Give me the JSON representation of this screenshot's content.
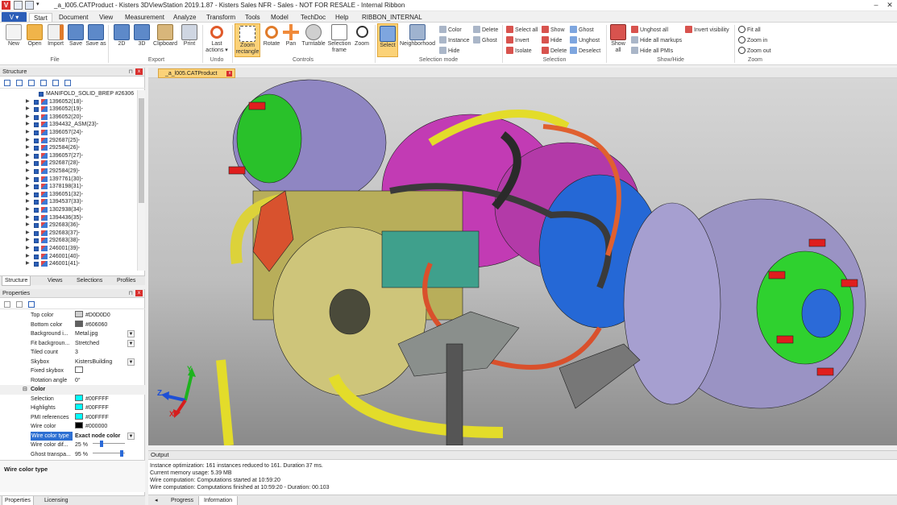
{
  "window": {
    "title": "_a_l005.CATProduct - Kisters 3DViewStation 2019.1.87 - Kisters Sales NFR - Sales - NOT FOR RESALE - Internal Ribbon",
    "min": "–",
    "close": "✕"
  },
  "menu": {
    "file_label": "V ▾",
    "tabs": [
      "Start",
      "Document",
      "View",
      "Measurement",
      "Analyze",
      "Transform",
      "Tools",
      "Model",
      "TechDoc",
      "Help",
      "RIBBON_INTERNAL"
    ],
    "active_tab": "Start"
  },
  "ribbon": {
    "file": {
      "new": "New",
      "open": "Open",
      "import": "Import",
      "save": "Save",
      "save_as": "Save as",
      "group": "File"
    },
    "export": {
      "e2d": "2D",
      "e3d": "3D",
      "clipboard": "Clipboard",
      "print": "Print",
      "group": "Export"
    },
    "undo": {
      "last_actions": "Last actions ▾",
      "group": "Undo"
    },
    "controls": {
      "zoom_rect": "Zoom rectangle",
      "rotate": "Rotate",
      "pan": "Pan",
      "turntable": "Turntable",
      "selection_frame": "Selection frame",
      "zoom": "Zoom",
      "group": "Controls"
    },
    "selmode": {
      "select": "Select",
      "neighborhood": "Neighborhood",
      "color": "Color",
      "instance": "Instance",
      "hide": "Hide",
      "delete": "Delete",
      "ghost": "Ghost",
      "group": "Selection mode"
    },
    "selection": {
      "select_all": "Select all",
      "invert": "Invert",
      "isolate": "Isolate",
      "show": "Show",
      "hide": "Hide",
      "delete": "Delete",
      "ghost": "Ghost",
      "unghost": "Unghost",
      "deselect": "Deselect",
      "group": "Selection"
    },
    "showhide": {
      "show_all": "Show all",
      "unghost_all": "Unghost all",
      "hide_all_markups": "Hide all markups",
      "hide_all_pmis": "Hide all PMIs",
      "invert_visibility": "Invert visibility",
      "group": "Show/Hide"
    },
    "zoomgrp": {
      "fit_all": "Fit all",
      "zoom_in": "Zoom in",
      "zoom_out": "Zoom out",
      "group": "Zoom"
    }
  },
  "structure": {
    "title": "Structure",
    "pin": "⊓",
    "x": "x",
    "root": "MANIFOLD_SOLID_BREP #26306",
    "items": [
      "1396052(18)-",
      "1396052(19)-",
      "1396052(20)-",
      "1394432_ASM(23)-",
      "1396057(24)-",
      "292687(25)-",
      "292584(26)-",
      "1396057(27)-",
      "292687(28)-",
      "292584(29)-",
      "1397761(30)-",
      "1378198(31)-",
      "1396051(32)-",
      "1394537(33)-",
      "1302938(34)-",
      "1394436(35)-",
      "292683(36)-",
      "292683(37)-",
      "292683(38)-",
      "246001(39)-",
      "246001(40)-",
      "246001(41)-"
    ],
    "bottom_tabs": [
      "Structure",
      "Views",
      "Selections",
      "Profiles"
    ]
  },
  "properties": {
    "title": "Properties",
    "rows": [
      {
        "key": "Top color",
        "value": "#D0D0D0",
        "swatch": "#d0d0d0"
      },
      {
        "key": "Bottom color",
        "value": "#606060",
        "swatch": "#606060"
      },
      {
        "key": "Background i...",
        "value": "Metal.jpg",
        "dd": true
      },
      {
        "key": "Fit backgroun...",
        "value": "Stretched",
        "dd": true
      },
      {
        "key": "Tiled count",
        "value": "3"
      },
      {
        "key": "Skybox",
        "value": "KistersBuilding",
        "dd": true
      },
      {
        "key": "Fixed skybox",
        "value": "",
        "check": true
      },
      {
        "key": "Rotation angle",
        "value": "0°"
      }
    ],
    "section_color": "Color",
    "color_rows": [
      {
        "key": "Selection",
        "value": "#00FFFF",
        "swatch": "#00ffff"
      },
      {
        "key": "Highlights",
        "value": "#00FFFF",
        "swatch": "#00ffff"
      },
      {
        "key": "PMI references",
        "value": "#00FFFF",
        "swatch": "#00ffff"
      },
      {
        "key": "Wire color",
        "value": "#000000",
        "swatch": "#000000"
      },
      {
        "key": "Wire color type",
        "value": "Exact node color",
        "dd": true,
        "sel": true
      },
      {
        "key": "Wire color dif...",
        "value": "25 %",
        "slider": 0.25
      },
      {
        "key": "Ghost transpa...",
        "value": "95 %",
        "slider": 0.95
      }
    ],
    "description_title": "Wire color type",
    "bottom_tabs": [
      "Properties",
      "Licensing"
    ]
  },
  "document": {
    "tab": "_a_l005.CATProduct"
  },
  "output": {
    "title": "Output",
    "lines": [
      "Instance optimization: 161 instances reduced to 161. Duration 37 ms.",
      "Current memory usage: 5.39 MB",
      "Wire computation: Computations started at 10:59:20",
      "Wire computation: Computations finished at 10:59:20 - Duration: 00.103"
    ],
    "tabs": [
      "Progress",
      "Information"
    ]
  },
  "axis": {
    "x": "X",
    "y": "Y",
    "z": "Z"
  },
  "colors": {
    "accent": "#2c5eb8",
    "zoom_highlight": "#fbd278",
    "selected_row": "#2d6fd2"
  }
}
